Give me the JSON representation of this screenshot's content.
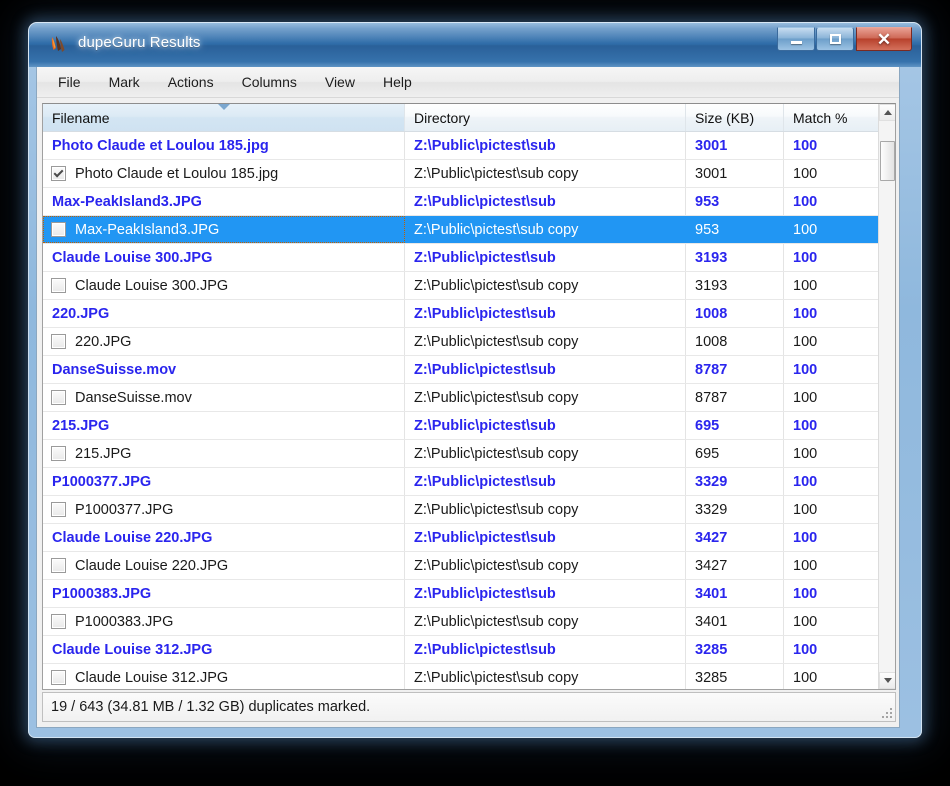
{
  "window": {
    "title": "dupeGuru Results",
    "app_icon": "dupeguru-logo-icon",
    "buttons": {
      "minimize": "minimize-icon",
      "maximize": "maximize-icon",
      "close": "close-icon"
    }
  },
  "menubar": {
    "items": [
      {
        "label": "File"
      },
      {
        "label": "Mark"
      },
      {
        "label": "Actions"
      },
      {
        "label": "Columns"
      },
      {
        "label": "View"
      },
      {
        "label": "Help"
      }
    ]
  },
  "table": {
    "columns": [
      {
        "key": "filename",
        "label": "Filename",
        "sorted": true,
        "sort_direction": "descending"
      },
      {
        "key": "directory",
        "label": "Directory",
        "sorted": false,
        "sort_direction": ""
      },
      {
        "key": "size",
        "label": "Size (KB)",
        "sorted": false,
        "sort_direction": ""
      },
      {
        "key": "match",
        "label": "Match %",
        "sorted": false,
        "sort_direction": ""
      }
    ],
    "rows": [
      {
        "type": "group",
        "checkbox": null,
        "filename": "Photo Claude et Loulou 185.jpg",
        "directory": "Z:\\Public\\pictest\\sub",
        "size": "3001",
        "match": "100",
        "selected": false
      },
      {
        "type": "dupe",
        "checkbox": "checked",
        "filename": "Photo Claude et Loulou 185.jpg",
        "directory": "Z:\\Public\\pictest\\sub copy",
        "size": "3001",
        "match": "100",
        "selected": false
      },
      {
        "type": "group",
        "checkbox": null,
        "filename": "Max-PeakIsland3.JPG",
        "directory": "Z:\\Public\\pictest\\sub",
        "size": "953",
        "match": "100",
        "selected": false
      },
      {
        "type": "dupe",
        "checkbox": "unchecked",
        "filename": "Max-PeakIsland3.JPG",
        "directory": "Z:\\Public\\pictest\\sub copy",
        "size": "953",
        "match": "100",
        "selected": true
      },
      {
        "type": "group",
        "checkbox": null,
        "filename": "Claude Louise 300.JPG",
        "directory": "Z:\\Public\\pictest\\sub",
        "size": "3193",
        "match": "100",
        "selected": false
      },
      {
        "type": "dupe",
        "checkbox": "unchecked",
        "filename": "Claude Louise 300.JPG",
        "directory": "Z:\\Public\\pictest\\sub copy",
        "size": "3193",
        "match": "100",
        "selected": false
      },
      {
        "type": "group",
        "checkbox": null,
        "filename": "220.JPG",
        "directory": "Z:\\Public\\pictest\\sub",
        "size": "1008",
        "match": "100",
        "selected": false
      },
      {
        "type": "dupe",
        "checkbox": "unchecked",
        "filename": "220.JPG",
        "directory": "Z:\\Public\\pictest\\sub copy",
        "size": "1008",
        "match": "100",
        "selected": false
      },
      {
        "type": "group",
        "checkbox": null,
        "filename": "DanseSuisse.mov",
        "directory": "Z:\\Public\\pictest\\sub",
        "size": "8787",
        "match": "100",
        "selected": false
      },
      {
        "type": "dupe",
        "checkbox": "unchecked",
        "filename": "DanseSuisse.mov",
        "directory": "Z:\\Public\\pictest\\sub copy",
        "size": "8787",
        "match": "100",
        "selected": false
      },
      {
        "type": "group",
        "checkbox": null,
        "filename": "215.JPG",
        "directory": "Z:\\Public\\pictest\\sub",
        "size": "695",
        "match": "100",
        "selected": false
      },
      {
        "type": "dupe",
        "checkbox": "unchecked",
        "filename": "215.JPG",
        "directory": "Z:\\Public\\pictest\\sub copy",
        "size": "695",
        "match": "100",
        "selected": false
      },
      {
        "type": "group",
        "checkbox": null,
        "filename": "P1000377.JPG",
        "directory": "Z:\\Public\\pictest\\sub",
        "size": "3329",
        "match": "100",
        "selected": false
      },
      {
        "type": "dupe",
        "checkbox": "unchecked",
        "filename": "P1000377.JPG",
        "directory": "Z:\\Public\\pictest\\sub copy",
        "size": "3329",
        "match": "100",
        "selected": false
      },
      {
        "type": "group",
        "checkbox": null,
        "filename": "Claude Louise 220.JPG",
        "directory": "Z:\\Public\\pictest\\sub",
        "size": "3427",
        "match": "100",
        "selected": false
      },
      {
        "type": "dupe",
        "checkbox": "unchecked",
        "filename": "Claude Louise 220.JPG",
        "directory": "Z:\\Public\\pictest\\sub copy",
        "size": "3427",
        "match": "100",
        "selected": false
      },
      {
        "type": "group",
        "checkbox": null,
        "filename": "P1000383.JPG",
        "directory": "Z:\\Public\\pictest\\sub",
        "size": "3401",
        "match": "100",
        "selected": false
      },
      {
        "type": "dupe",
        "checkbox": "unchecked",
        "filename": "P1000383.JPG",
        "directory": "Z:\\Public\\pictest\\sub copy",
        "size": "3401",
        "match": "100",
        "selected": false
      },
      {
        "type": "group",
        "checkbox": null,
        "filename": "Claude Louise 312.JPG",
        "directory": "Z:\\Public\\pictest\\sub",
        "size": "3285",
        "match": "100",
        "selected": false
      },
      {
        "type": "dupe",
        "checkbox": "unchecked",
        "filename": "Claude Louise 312.JPG",
        "directory": "Z:\\Public\\pictest\\sub copy",
        "size": "3285",
        "match": "100",
        "selected": false
      }
    ]
  },
  "scrollbar": {
    "orientation": "vertical",
    "up_arrow": "scroll-up-icon",
    "down_arrow": "scroll-down-icon",
    "thumb_position_pct": 4
  },
  "statusbar": {
    "text": "19 / 643 (34.81 MB / 1.32 GB) duplicates marked.",
    "marked_count": "19",
    "total_count": "643",
    "marked_size": "34.81 MB",
    "total_size": "1.32 GB",
    "resize_grip": "resize-grip-icon"
  },
  "colors": {
    "group_text": "#2a25ee",
    "selection": "#2196f3",
    "titlebar": "#2f6ca8",
    "close_button": "#b8412c"
  }
}
